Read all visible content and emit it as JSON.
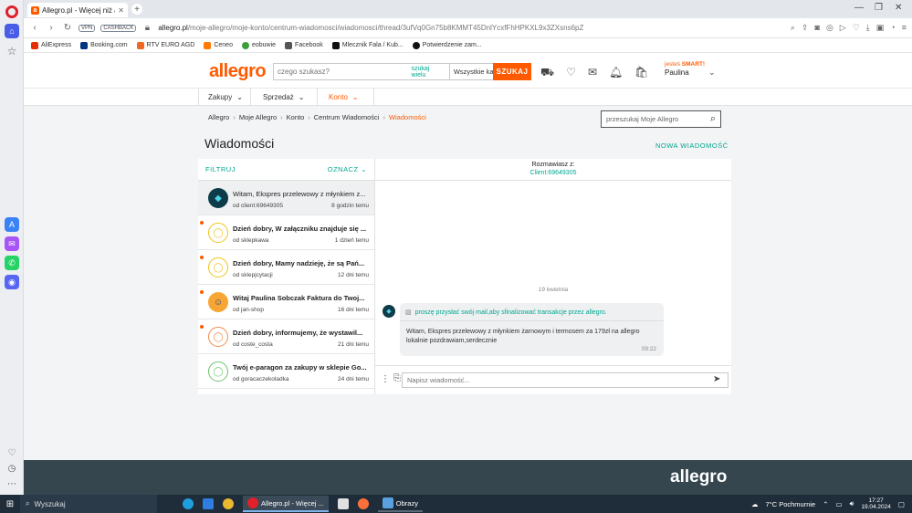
{
  "browser": {
    "tab_title": "Allegro.pl - Więcej niż aukcje",
    "url_host": "allegro.pl",
    "url_path": "/moje-allegro/moje-konto/centrum-wiadomosci/wiadomosci/thread/3ufVq0Gn75b8KMMT45DnlYcxfFhHPKXL9x3ZXsns6pZ",
    "vpn": "VPN",
    "cashback": "CASHBACK",
    "bookmarks": [
      {
        "label": "AliExpress",
        "color": "#e62e04"
      },
      {
        "label": "Booking.com",
        "color": "#003580"
      },
      {
        "label": "RTV EURO AGD",
        "color": "#f26522"
      },
      {
        "label": "Ceneo",
        "color": "#ff7a00"
      },
      {
        "label": "eobuwie",
        "color": "#3b9e3b"
      },
      {
        "label": "Facebook",
        "color": "#555555"
      },
      {
        "label": "Mlecznik Fala / Kub...",
        "color": "#111111"
      },
      {
        "label": "Potwierdzenie zam...",
        "color": "#111111"
      }
    ]
  },
  "header": {
    "logo": "allegro",
    "search_placeholder": "czego szukasz?",
    "search_many": "szukaj wielu",
    "category": "Wszystkie kategorie",
    "search_button": "SZUKAJ",
    "user_prefix": "jesteś ",
    "user_smart": "SMART!",
    "user_name": "Paulina"
  },
  "subnav": [
    {
      "label": "Zakupy"
    },
    {
      "label": "Sprzedaż"
    },
    {
      "label": "Konto"
    }
  ],
  "breadcrumbs": [
    "Allegro",
    "Moje Allegro",
    "Konto",
    "Centrum Wiadomości",
    "Wiadomości"
  ],
  "message_search_placeholder": "przeszukaj Moje Allegro",
  "page_title": "Wiadomości",
  "new_message": "NOWA WIADOMOŚĆ",
  "list": {
    "filter": "FILTRUJ",
    "mark": "OZNACZ",
    "threads": [
      {
        "subject": "Witam, Ekspres przelewowy z młynkiem z...",
        "from": "od client:69649305",
        "when": "8 godzin temu"
      },
      {
        "subject": "Dzień dobry, W załączniku znajduje się ...",
        "from": "od sklepkawa",
        "when": "1 dzień temu"
      },
      {
        "subject": "Dzień dobry, Mamy nadzieję, że są Pań...",
        "from": "od sklepjcytacji",
        "when": "12 dni temu"
      },
      {
        "subject": "Witaj Paulina Sobczak Faktura do Twoj...",
        "from": "od jan-shop",
        "when": "16 dni temu"
      },
      {
        "subject": "Dzień dobry, informujemy, że wystawil...",
        "from": "od coste_costa",
        "when": "21 dni temu"
      },
      {
        "subject": "Twój e-paragon za zakupy w sklepie Go...",
        "from": "od goracaczekoladka",
        "when": "24 dni temu"
      }
    ]
  },
  "conversation": {
    "with_label": "Rozmawiasz z:",
    "with_client": "Client:69649305",
    "date": "19 kwietnia",
    "notice": "proszę przysłać swój mail,aby sfinalizować transakcje przez allegro.",
    "text": "Witam, Ekspres przelewowy z młynkiem żarnowym i termosem za 179zł na allegro lokalnie pozdrawiam,serdecznie",
    "time": "09:22",
    "compose_placeholder": "Napisz wiadomość..."
  },
  "footer_logo": "allegro",
  "taskbar": {
    "search": "Wyszukaj",
    "active_app": "Allegro.pl - Więcej ...",
    "other_app": "Obrazy",
    "weather": "7°C  Pochmurnie",
    "time": "17:27",
    "date": "19.04.2024"
  },
  "colors": {
    "brand": "#ff5a00",
    "accent": "#00a790",
    "footer": "#35464f"
  }
}
